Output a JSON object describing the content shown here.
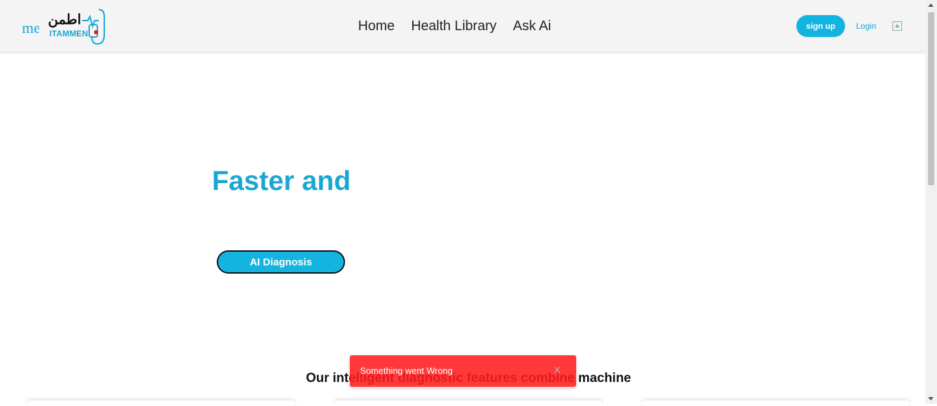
{
  "header": {
    "brand_fragment": "me",
    "logo_ar": "اطمن",
    "logo_en": "ITAMMEN",
    "nav": [
      "Home",
      "Health Library",
      "Ask Ai"
    ],
    "signup_label": "sign up",
    "login_label": "Login"
  },
  "hero": {
    "title": "Faster and",
    "cta_label": "AI Diagnosis"
  },
  "features": {
    "text": "Our intelligent diagnostic features combine machine"
  },
  "toast": {
    "message": "Something went Wrong",
    "close_label": "X"
  },
  "colors": {
    "accent": "#14b4e0",
    "toast_bg": "#ff1e1e"
  }
}
